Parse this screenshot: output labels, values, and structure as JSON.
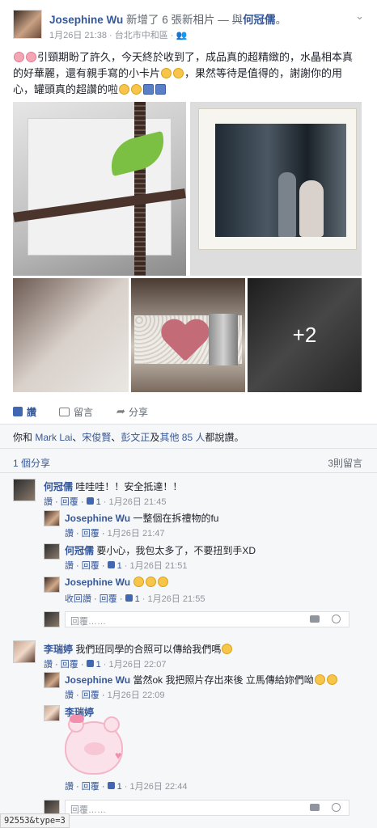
{
  "post": {
    "author": "Josephine Wu",
    "action": "新增了 6 張新相片",
    "with_sep": " — 與",
    "with_name": "何冠儒",
    "with_end": "。",
    "timestamp": "1月26日 21:38",
    "location": "· 台北市中和區 ·",
    "text": "引頸期盼了許久，今天終於收到了，成品真的超精緻的，水晶相本真的好華麗，還有親手寫的小卡片",
    "text2": "，果然等待是值得的，謝謝你的用心，罐頭真的超讚的啦",
    "more_photos": "+2"
  },
  "actions": {
    "like": "讚",
    "comment": "留言",
    "share": "分享"
  },
  "likes_line": {
    "prefix": "你和 ",
    "name1": "Mark Lai",
    "sep1": "、",
    "name2": "宋俊賢",
    "sep2": "、",
    "name3": "彭文正",
    "mid": "及",
    "others": "其他 85 人",
    "suffix": "都說讚。"
  },
  "shares": "1 個分享",
  "comment_count": "3則留言",
  "comments": [
    {
      "name": "何冠儒",
      "text": "哇哇哇！！安全抵達！！",
      "meta_actions": "讚 · 回覆 · ",
      "likes": "1",
      "time": " · 1月26日 21:45"
    },
    {
      "name": "Josephine Wu",
      "text": "一整個在拆禮物的fu",
      "meta_actions": "讚 · 回覆 ·",
      "time": "1月26日 21:47"
    },
    {
      "name": "何冠儒",
      "text": "要小心，我包太多了，不要扭到手XD",
      "meta_actions": "讚 · 回覆 · ",
      "likes": "1",
      "time": " · 1月26日 21:51"
    },
    {
      "name": "Josephine Wu",
      "text": "",
      "meta_actions": "收回讚 · 回覆 · ",
      "likes": "1",
      "time": " · 1月26日 21:55"
    },
    {
      "name": "李瑞婷",
      "text": "我們班同學的合照可以傳給我們嗎",
      "meta_actions": "讚 · 回覆 · ",
      "likes": "1",
      "time": " · 1月26日 22:07"
    },
    {
      "name": "Josephine Wu",
      "text": "當然ok 我把照片存出來後 立馬傳給妳們呦",
      "meta_actions": "讚 · 回覆 ·",
      "time": "1月26日 22:09"
    },
    {
      "name": "李瑞婷",
      "text": "",
      "meta_actions": "讚 · 回覆 · ",
      "likes": "1",
      "time": " · 1月26日 22:44"
    }
  ],
  "reply_placeholder": "回覆……",
  "status_url": "92553&type=3"
}
